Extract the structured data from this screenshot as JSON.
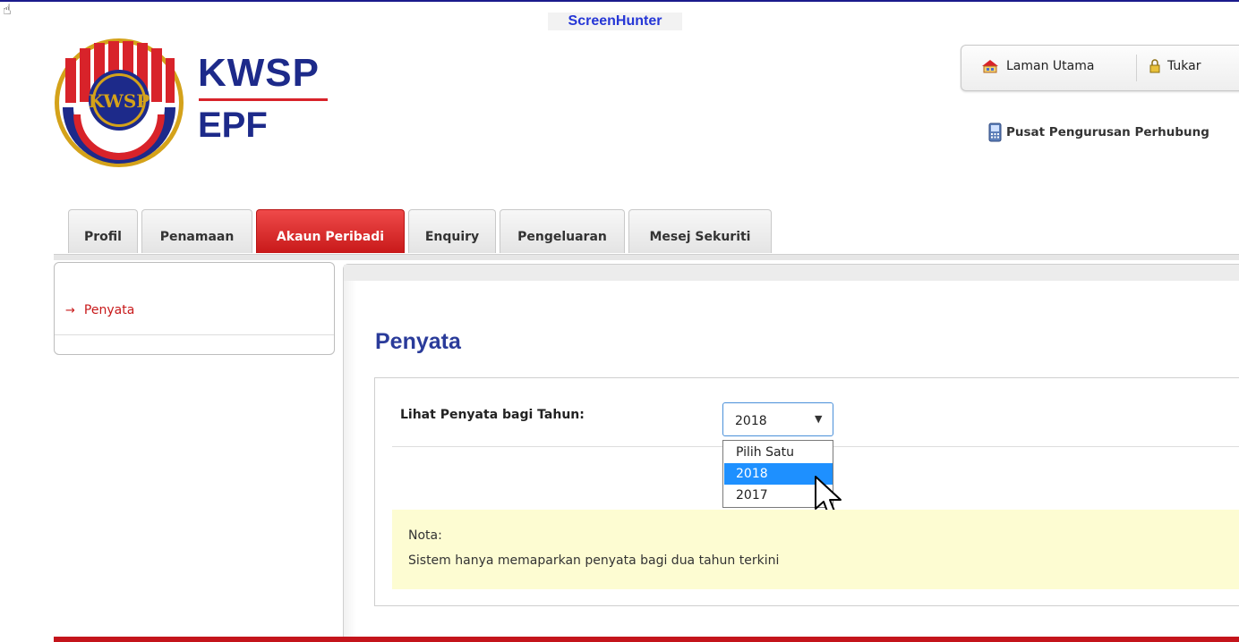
{
  "overlay": {
    "app_label": "ScreenHunter"
  },
  "brand": {
    "line1": "KWSP",
    "line2": "EPF",
    "seal_text": "KWSP",
    "colors": {
      "navy": "#1d2a8a",
      "red": "#d8232a",
      "gold": "#d4a21a"
    }
  },
  "header_links": [
    {
      "label": "Laman Utama",
      "icon": "home-icon"
    },
    {
      "label": "Tukar",
      "icon": "lock-icon"
    }
  ],
  "contact": {
    "label": "Pusat Pengurusan Perhubung",
    "icon": "phone-icon"
  },
  "tabs": [
    "Profil",
    "Penamaan",
    "Akaun Peribadi",
    "Enquiry",
    "Pengeluaran",
    "Mesej Sekuriti"
  ],
  "active_tab": "Akaun Peribadi",
  "sidebar": {
    "items": [
      {
        "label": "Penyata",
        "icon": "arrow-right-icon"
      }
    ]
  },
  "page": {
    "title": "Penyata"
  },
  "form": {
    "year_label": "Lihat Penyata bagi Tahun:",
    "selected_year": "2018",
    "options": [
      "Pilih Satu",
      "2018",
      "2017"
    ],
    "highlighted_option": "2018"
  },
  "note": {
    "title": "Nota:",
    "text": "Sistem hanya memaparkan penyata bagi dua tahun terkini"
  },
  "theme": {
    "accent_red": "#c8191a",
    "title_blue": "#2a3b9a",
    "note_bg": "#fdfcd2",
    "select_highlight": "#1e90ff"
  }
}
